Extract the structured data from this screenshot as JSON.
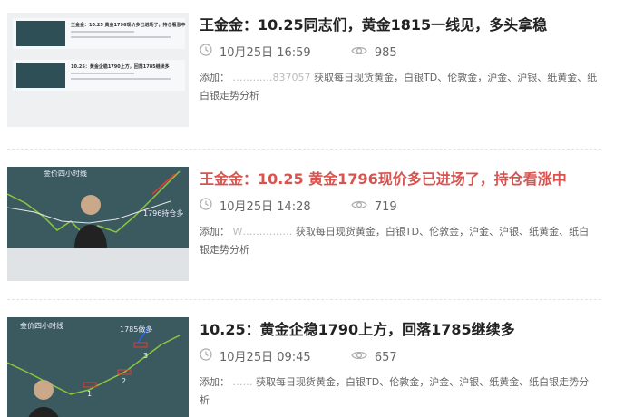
{
  "articles": [
    {
      "title": "王金金：10.25同志们，黄金1815一线见，多头拿稳",
      "date": "10月25日 16:59",
      "views": "985",
      "desc_prefix": "添加：",
      "desc_contact": "…………837057",
      "desc_text": "获取每日现货黄金，白银TD、伦敦金，沪金、沪银、纸黄金、纸白银走势分析",
      "thumb": {
        "row1_title": "王金金：10.25 黄金1796现价多已进场了，持仓看涨中",
        "row2_title": "10.25：黄金企稳1790上方，回落1785继续多"
      }
    },
    {
      "title": "王金金：10.25 黄金1796现价多已进场了，持仓看涨中",
      "date": "10月25日 14:28",
      "views": "719",
      "desc_prefix": "添加：",
      "desc_contact": "W……………",
      "desc_text": "获取每日现货黄金，白银TD、伦敦金，沪金、沪银、纸黄金、纸白银走势分析",
      "thumb": {
        "header": "金价四小时线",
        "caption": "1796持仓多"
      }
    },
    {
      "title": "10.25：黄金企稳1790上方，回落1785继续多",
      "date": "10月25日 09:45",
      "views": "657",
      "desc_prefix": "添加：",
      "desc_contact": "……",
      "desc_text": "获取每日现货黄金，白银TD、伦敦金，沪金、沪银、纸黄金、纸白银走势分析",
      "thumb": {
        "header": "金价四小时线",
        "caption": "1785做多",
        "n1": "1",
        "n2": "2",
        "n3": "3"
      }
    }
  ],
  "colors": {
    "active_title": "#d9534f",
    "title": "#222222",
    "meta": "#666666"
  },
  "icons": {
    "clock": "clock-icon",
    "views": "eye-icon"
  }
}
